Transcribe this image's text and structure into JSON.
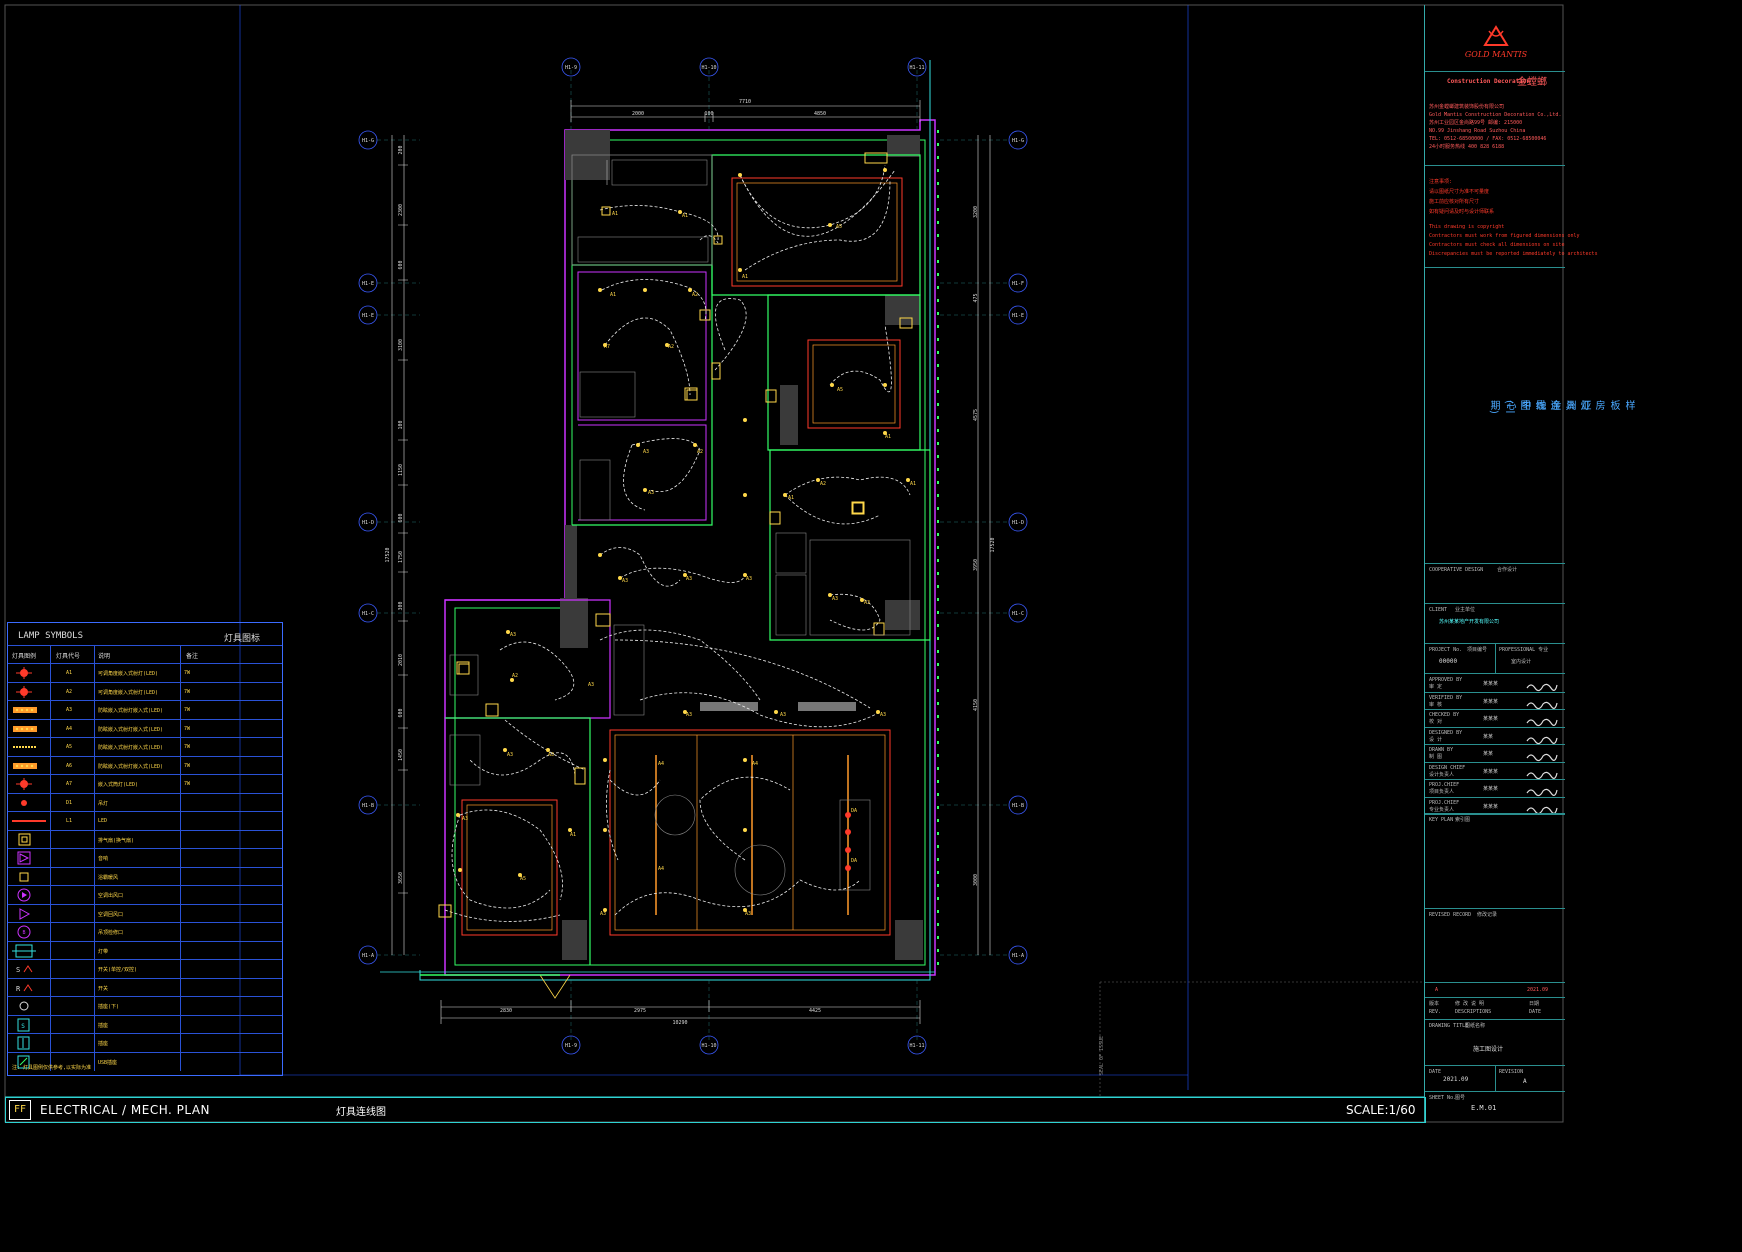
{
  "sheet": {
    "plan_title": "ELECTRICAL / MECH. PLAN",
    "plan_title_cn": "灯具连线图",
    "scale": "SCALE:1/60",
    "ff": "FF"
  },
  "grid": {
    "top": [
      "H1-9",
      "H1-10",
      "H1-11"
    ],
    "bottom": [
      "H1-9",
      "H1-10",
      "H1-11"
    ],
    "left": [
      "H1-G",
      "H1-E",
      "H1-E",
      "H1-D",
      "H1-C",
      "H1-B",
      "H1-A"
    ],
    "right": [
      "H1-G",
      "H1-F",
      "H1-E",
      "H1-D",
      "H1-C",
      "H1-B",
      "H1-A"
    ]
  },
  "dimensions": {
    "top_total": "7710",
    "top_parts": [
      "2000",
      "100",
      "4850"
    ],
    "bottom_total": "10290",
    "bottom_parts": [
      "2830",
      "2975",
      "4425"
    ],
    "left": [
      "200",
      "2300",
      "600",
      "3100",
      "100",
      "1150",
      "600",
      "1750",
      "300",
      "2010",
      "600",
      "1450",
      "3650"
    ],
    "left_total": "17520",
    "right": [
      "3200",
      "475",
      "4575",
      "3950",
      "4150",
      "3000"
    ],
    "right_total": "17520"
  },
  "fixture_labels": [
    "A1",
    "A2",
    "A3",
    "A4",
    "A5",
    "A6",
    "A7",
    "A8",
    "A9"
  ],
  "legend": {
    "title": "LAMP SYMBOLS",
    "title_cn": "灯具图标",
    "headers": [
      "灯具图例",
      "灯具代号",
      "说明",
      "备注"
    ],
    "rows": [
      {
        "code": "A1",
        "desc": "可调角度嵌入式射灯(LED)",
        "note": "7W",
        "icon": "spotlight-red"
      },
      {
        "code": "A2",
        "desc": "可调角度嵌入式射灯(LED)",
        "note": "7W",
        "icon": "spotlight-red"
      },
      {
        "code": "A3",
        "desc": "防眩嵌入式射灯嵌入式(LED)",
        "note": "7W",
        "icon": "strip-yellow"
      },
      {
        "code": "A4",
        "desc": "防眩嵌入式射灯嵌入式(LED)",
        "note": "7W",
        "icon": "strip-yellow"
      },
      {
        "code": "A5",
        "desc": "防眩嵌入式射灯嵌入式(LED)",
        "note": "7W",
        "icon": "strip-dashed"
      },
      {
        "code": "A6",
        "desc": "防眩嵌入式射灯嵌入式(LED)",
        "note": "7W",
        "icon": "strip-yellow"
      },
      {
        "code": "A7",
        "desc": "嵌入式筒灯(LED)",
        "note": "7W",
        "icon": "spotlight-red"
      },
      {
        "code": "D1",
        "desc": "吊灯",
        "note": "",
        "icon": "pendant-red"
      },
      {
        "code": "L1",
        "desc": "LED",
        "note": "",
        "icon": "led-line"
      },
      {
        "code": "",
        "desc": "排气扇(换气扇)",
        "note": "",
        "icon": "square-yellow"
      },
      {
        "code": "",
        "desc": "音响",
        "note": "",
        "icon": "triangle-magenta"
      },
      {
        "code": "",
        "desc": "浴霸暖风",
        "note": "",
        "icon": "small-square-yellow"
      },
      {
        "code": "",
        "desc": "空调出风口",
        "note": "",
        "icon": "circle-magenta"
      },
      {
        "code": "",
        "desc": "空调回风口",
        "note": "",
        "icon": "triangle-circle-magenta"
      },
      {
        "code": "",
        "desc": "吊顶检修口",
        "note": "",
        "icon": "circle-magenta-b"
      },
      {
        "code": "",
        "desc": "灯带",
        "note": "",
        "icon": "box-cyan"
      },
      {
        "code": "",
        "desc": "开关(单控/双控)",
        "note": "",
        "icon": "switch-s"
      },
      {
        "code": "",
        "desc": "开关",
        "note": "",
        "icon": "switch-r"
      },
      {
        "code": "",
        "desc": "插座(下)",
        "note": "",
        "icon": "circle-white"
      },
      {
        "code": "",
        "desc": "插座",
        "note": "",
        "icon": "box-cyan-s"
      },
      {
        "code": "",
        "desc": "插座",
        "note": "",
        "icon": "box-cyan-d"
      },
      {
        "code": "",
        "desc": "USB插座",
        "note": "",
        "icon": "box-cyan-u"
      }
    ],
    "footnote": "注: 灯具图例仅供参考,以实际为准"
  },
  "titleblock": {
    "logo_text": "GOLD MANTIS",
    "company_en": "Construction Decoration",
    "company_cn": "金螳螂",
    "address_lines": [
      "苏州金螳螂建筑装饰股份有限公司",
      "Gold Mantis Construction Decoration Co.,Ltd.",
      "苏州工业园区金尚路99号 邮编: 215000",
      "NO.99 Jinshang Road Suzhou China",
      "TEL: 0512-68500000 / FAX: 0512-68500046",
      "24小时服务热线 400 828 6188"
    ],
    "notes_cn": [
      "注意事项:",
      "请以图纸尺寸为准不可量度",
      "施工前应核对所有尺寸",
      "如有疑问请及时与设计师联系"
    ],
    "notes_en": [
      "This drawing is copyright",
      "Contractors must work from figured dimensions only",
      "Contractors must check all dimensions on site",
      "Discrepancies must be reported immediately to architects"
    ],
    "project_name_vertical": [
      "亚洲金融中心",
      "样板房灯具连线图(二期)"
    ],
    "cooperative": "COOPERATIVE DESIGN",
    "cooperative_cn": "合作设计",
    "client_label": "CLIENT",
    "client_cn_label": "业主单位",
    "client_value": "苏州某某地产开发有限公司",
    "project_no_label": "PROJECT No.",
    "project_no_cn": "项目编号",
    "project_no": "00000",
    "professional_label": "PROFESSIONAL 专业",
    "professional_value": "室内设计",
    "roles": [
      {
        "en": "APPROVED BY",
        "cn": "审 定",
        "name": "某某某"
      },
      {
        "en": "VERIFIED BY",
        "cn": "审 核",
        "name": "某某某"
      },
      {
        "en": "CHECKED BY",
        "cn": "校 对",
        "name": "某某某"
      },
      {
        "en": "DESIGNED BY",
        "cn": "设 计",
        "name": "某某"
      },
      {
        "en": "DRAWN BY",
        "cn": "制 图",
        "name": "某某"
      },
      {
        "en": "DESIGN CHIEF",
        "cn": "设计负责人",
        "name": "某某某"
      },
      {
        "en": "PROJ.CHIEF",
        "cn": "项目负责人",
        "name": "某某某"
      },
      {
        "en": "PROJ.CHIEF",
        "cn": "专业负责人",
        "name": "某某某"
      }
    ],
    "key_plan": "KEY PLAN",
    "key_plan_cn": "索引图",
    "revised_record": "REVISED RECORD",
    "revised_record_cn": "修改记录",
    "rev_row": {
      "rev": "A",
      "date": "2021.09"
    },
    "rev_headers": [
      "REV.",
      "DESCRIPTIONS",
      "DATE"
    ],
    "rev_headers_cn": [
      "版本",
      "修 改 说 明",
      "日期"
    ],
    "drawing_title_label": "DRAWING TITLE",
    "drawing_title_cn": "图纸名称",
    "drawing_title": "施工图设计",
    "date_label": "DATE",
    "date_value": "2021.09",
    "revision_label": "REVISION",
    "revision_value": "A",
    "sheet_no_label": "SHEET No.",
    "sheet_no_cn": "图号",
    "sheet_no": "E.M.01"
  },
  "colors": {
    "background": "#000000",
    "wall": "#3a3a3a",
    "outline_magenta": "#cc33ff",
    "outline_green": "#33ff66",
    "outline_cyan": "#33e0e0",
    "fixture_yellow": "#ffd84a",
    "ceiling_red": "#ff3a2a",
    "ceiling_orange": "#ff9a2a",
    "grid_blue": "#3b5bff",
    "dim_white": "#dddddd",
    "wire": "#ffffff"
  }
}
